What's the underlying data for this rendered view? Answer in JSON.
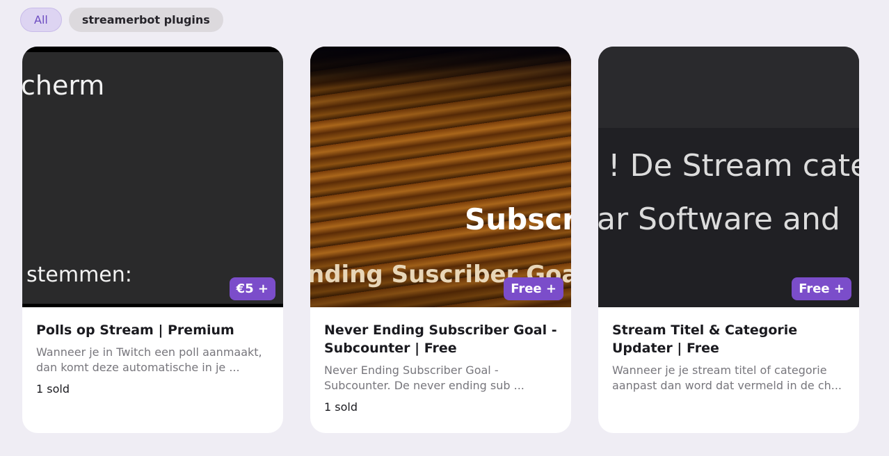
{
  "filters": [
    {
      "label": "All",
      "active": true
    },
    {
      "label": "streamerbot plugins",
      "active": false
    }
  ],
  "cards": [
    {
      "thumb_text_1": "cherm",
      "thumb_text_2": "stemmen:",
      "price": "€5 +",
      "title": "Polls op Stream | Premium",
      "description": "Wanneer je in Twitch een poll aanmaakt, dan komt deze automatische in je ...",
      "sold": "1 sold"
    },
    {
      "thumb_text_1": "Subscr",
      "thumb_text_2": "nding Suscriber Goal",
      "price": "Free +",
      "title": "Never Ending Subscriber Goal - Subcounter | Free",
      "description": "Never Ending Subscriber Goal - Subcounter. De never ending sub ...",
      "sold": "1 sold"
    },
    {
      "thumb_text_1": "! De Stream cate",
      "thumb_text_2": "ar Software and",
      "price": "Free +",
      "title": "Stream Titel & Categorie Updater | Free",
      "description": "Wanneer je je stream titel of categorie aanpast dan word dat vermeld in de ch..."
    }
  ]
}
